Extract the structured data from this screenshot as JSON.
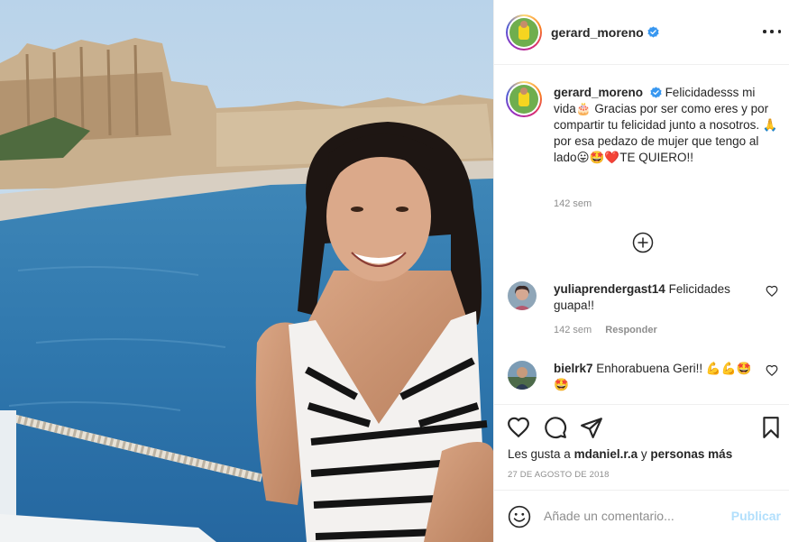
{
  "post": {
    "photo_alt": "photo",
    "author": {
      "username": "gerard_moreno",
      "verified": true
    },
    "caption": {
      "text": "Felicidadesss mi vida🎂 Gracias por ser como eres y por compartir tu felicidad junto a nosotros. 🙏 por esa pedazo de mujer que tengo al lado😛🤩❤️TE QUIERO!!",
      "text_before_cake": "Felicidadesss mi vida",
      "text_after_cake": " Gracias por ser como eres y por compartir tu felicidad junto a nosotros. ",
      "text_after_hands": " por esa pedazo de mujer que tengo al lado",
      "text_end": "TE QUIERO!!",
      "time": "142 sem"
    },
    "comments": [
      {
        "username": "yuliaprendergast14",
        "text": "Felicidades guapa!!",
        "time": "142 sem",
        "reply_label": "Responder"
      },
      {
        "username": "bielrk7",
        "text": "Enhorabuena Geri!! 💪💪🤩🤩",
        "text_plain": "Enhorabuena Geri!!"
      }
    ],
    "likes": {
      "prefix": "Les gusta a",
      "user": "mdaniel.r.a",
      "joiner": "y",
      "others": "personas más"
    },
    "date": "27 DE AGOSTO DE 2018",
    "add_comment": {
      "placeholder": "Añade un comentario...",
      "post_label": "Publicar"
    }
  },
  "icons": {
    "more": "more-options-icon",
    "verified": "verified-badge-icon",
    "load_more": "plus-circle-icon",
    "like": "heart-icon",
    "comment": "comment-bubble-icon",
    "share": "paper-plane-icon",
    "save": "bookmark-icon",
    "emoji": "smiley-icon"
  },
  "colors": {
    "verified": "#3897f0",
    "text": "#262626",
    "secondary": "#8e8e8e",
    "border": "#efefef",
    "post_disabled": "#b2dffc",
    "heart": "#ed4956"
  }
}
